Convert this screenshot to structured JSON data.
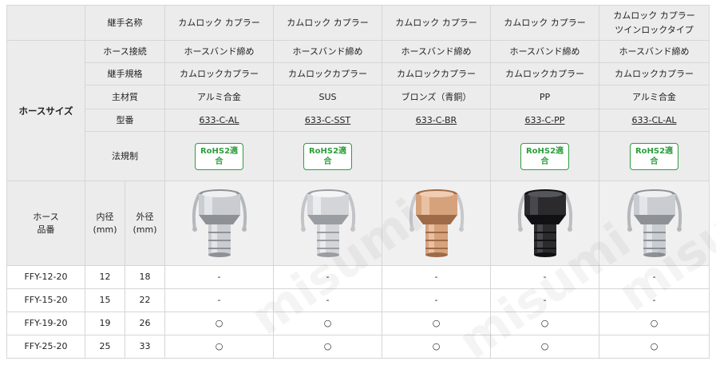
{
  "hose_size_label": "ホースサイズ",
  "row_labels": {
    "name": "継手名称",
    "hose_connection": "ホース接続",
    "standard": "継手規格",
    "material": "主材質",
    "model": "型番",
    "regulation": "法規制"
  },
  "bottom_header": {
    "hose_part": "ホース\n品番",
    "inner": "内径\n(mm)",
    "outer": "外径\n(mm)"
  },
  "columns": [
    {
      "name": "カムロック カプラー",
      "hose_connection": "ホースバンド締め",
      "standard": "カムロックカプラー",
      "material": "アルミ合金",
      "model": "633-C-AL",
      "rohs": "RoHS2適\n合",
      "finish": "aluminum"
    },
    {
      "name": "カムロック カプラー",
      "hose_connection": "ホースバンド締め",
      "standard": "カムロックカプラー",
      "material": "SUS",
      "model": "633-C-SST",
      "rohs": "RoHS2適\n合",
      "finish": "steel"
    },
    {
      "name": "カムロック カプラー",
      "hose_connection": "ホースバンド締め",
      "standard": "カムロックカプラー",
      "material": "ブロンズ（青銅）",
      "model": "633-C-BR",
      "rohs": "",
      "finish": "bronze"
    },
    {
      "name": "カムロック カプラー",
      "hose_connection": "ホースバンド締め",
      "standard": "カムロックカプラー",
      "material": "PP",
      "model": "633-C-PP",
      "rohs": "RoHS2適\n合",
      "finish": "pp"
    },
    {
      "name": "カムロック カプラー\nツインロックタイプ",
      "hose_connection": "ホースバンド締め",
      "standard": "カムロックカプラー",
      "material": "アルミ合金",
      "model": "633-CL-AL",
      "rohs": "RoHS2適\n合",
      "finish": "aluminum"
    }
  ],
  "rows": [
    {
      "part": "FFY-12-20",
      "inner": "12",
      "outer": "18",
      "cells": [
        "-",
        "-",
        "-",
        "-",
        "-"
      ]
    },
    {
      "part": "FFY-15-20",
      "inner": "15",
      "outer": "22",
      "cells": [
        "-",
        "-",
        "-",
        "-",
        "-"
      ]
    },
    {
      "part": "FFY-19-20",
      "inner": "19",
      "outer": "26",
      "cells": [
        "○",
        "○",
        "○",
        "○",
        "○"
      ]
    },
    {
      "part": "FFY-25-20",
      "inner": "25",
      "outer": "33",
      "cells": [
        "○",
        "○",
        "○",
        "○",
        "○"
      ]
    }
  ],
  "watermark": "misumi",
  "colors": {
    "rohs_green": "#2e9e3e",
    "header_gray": "#ececec"
  }
}
